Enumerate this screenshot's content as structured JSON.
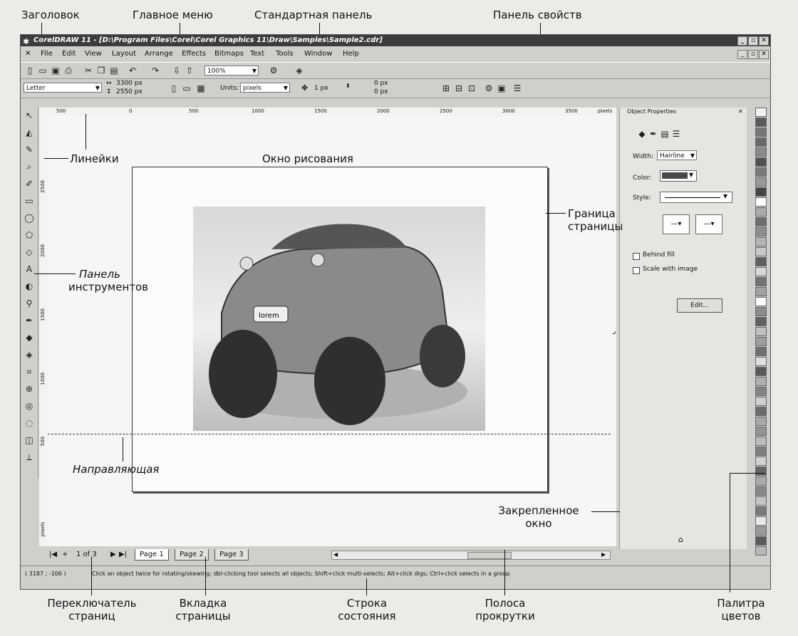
{
  "callouts": {
    "title_bar": "Заголовок",
    "main_menu": "Главное меню",
    "standard_panel": "Стандартная панель",
    "property_bar": "Панель свойств",
    "rulers": "Линейки",
    "drawing_window": "Окно рисования",
    "page_border_1": "Граница",
    "page_border_2": "страницы",
    "toolbox_1": "Панель",
    "toolbox_2": "инструментов",
    "guideline": "Направляющая",
    "docker_1": "Закрепленное",
    "docker_2": "окно",
    "page_switcher_1": "Переключатель",
    "page_switcher_2": "страниц",
    "page_tab_1": "Вкладка",
    "page_tab_2": "страницы",
    "status_bar_1": "Строка",
    "status_bar_2": "состояния",
    "scrollbar_1": "Полоса",
    "scrollbar_2": "прокрутки",
    "palette_1": "Палитра",
    "palette_2": "цветов"
  },
  "window": {
    "title": "CorelDRAW 11 - [D:\\Program Files\\Corel\\Corel Graphics 11\\Draw\\Samples\\Sample2.cdr]"
  },
  "menu": [
    "File",
    "Edit",
    "View",
    "Layout",
    "Arrange",
    "Effects",
    "Bitmaps",
    "Text",
    "Tools",
    "Window",
    "Help"
  ],
  "toolbar": {
    "zoom": "100%"
  },
  "propbar": {
    "paper": "Letter",
    "width": "3300 px",
    "height": "2550 px",
    "units_label": "Units:",
    "units": "pixels",
    "nudge": "1 px",
    "dup_x": "0 px",
    "dup_y": "0 px"
  },
  "ruler": {
    "h_ticks": [
      "500",
      "0",
      "500",
      "1000",
      "1500",
      "2000",
      "2500",
      "3000",
      "3500",
      "pixels"
    ],
    "v_ticks": [
      "2500",
      "2000",
      "1500",
      "1000",
      "500",
      "pixels"
    ]
  },
  "docker": {
    "title": "Object Properties",
    "width_label": "Width:",
    "width_value": "Hairline",
    "color_label": "Color:",
    "style_label": "Style:",
    "behind_fill": "Behind fill",
    "scale_with_image": "Scale with image",
    "edit_button": "Edit..."
  },
  "photo": {
    "plate_text": "lorem"
  },
  "palette_colors": [
    "#f2f2f2",
    "#5a5a5a",
    "#777777",
    "#6a6a6a",
    "#8a8a8a",
    "#505050",
    "#7a7a7a",
    "#9a9a9a",
    "#454545",
    "#ffffff",
    "#aaaaaa",
    "#6e6e6e",
    "#8e8e8e",
    "#b5b5b5",
    "#c9c9c9",
    "#5f5f5f",
    "#d8d8d8",
    "#747474",
    "#a2a2a2",
    "#ffffff",
    "#8c8c8c",
    "#606060",
    "#c0c0c0",
    "#9e9e9e",
    "#707070",
    "#e0e0e0",
    "#585858",
    "#b0b0b0",
    "#848484",
    "#cfcfcf",
    "#6b6b6b",
    "#a8a8a8",
    "#939393",
    "#bcbcbc",
    "#7e7e7e",
    "#d2d2d2",
    "#656565",
    "#ababab",
    "#888888",
    "#c4c4c4",
    "#7a7a7a",
    "#e8e8e8",
    "#9a9a9a",
    "#5c5c5c",
    "#b8b8b8"
  ],
  "pager": {
    "counter": "1 of 3",
    "tabs": [
      "Page 1",
      "Page 2",
      "Page 3"
    ]
  },
  "status": {
    "coords": "( 3187 ; -106 )",
    "message": "Click an object twice for rotating/skewing; dbl-clicking tool selects all objects; Shift+click multi-selects; Alt+click digs; Ctrl+click selects in a group"
  }
}
